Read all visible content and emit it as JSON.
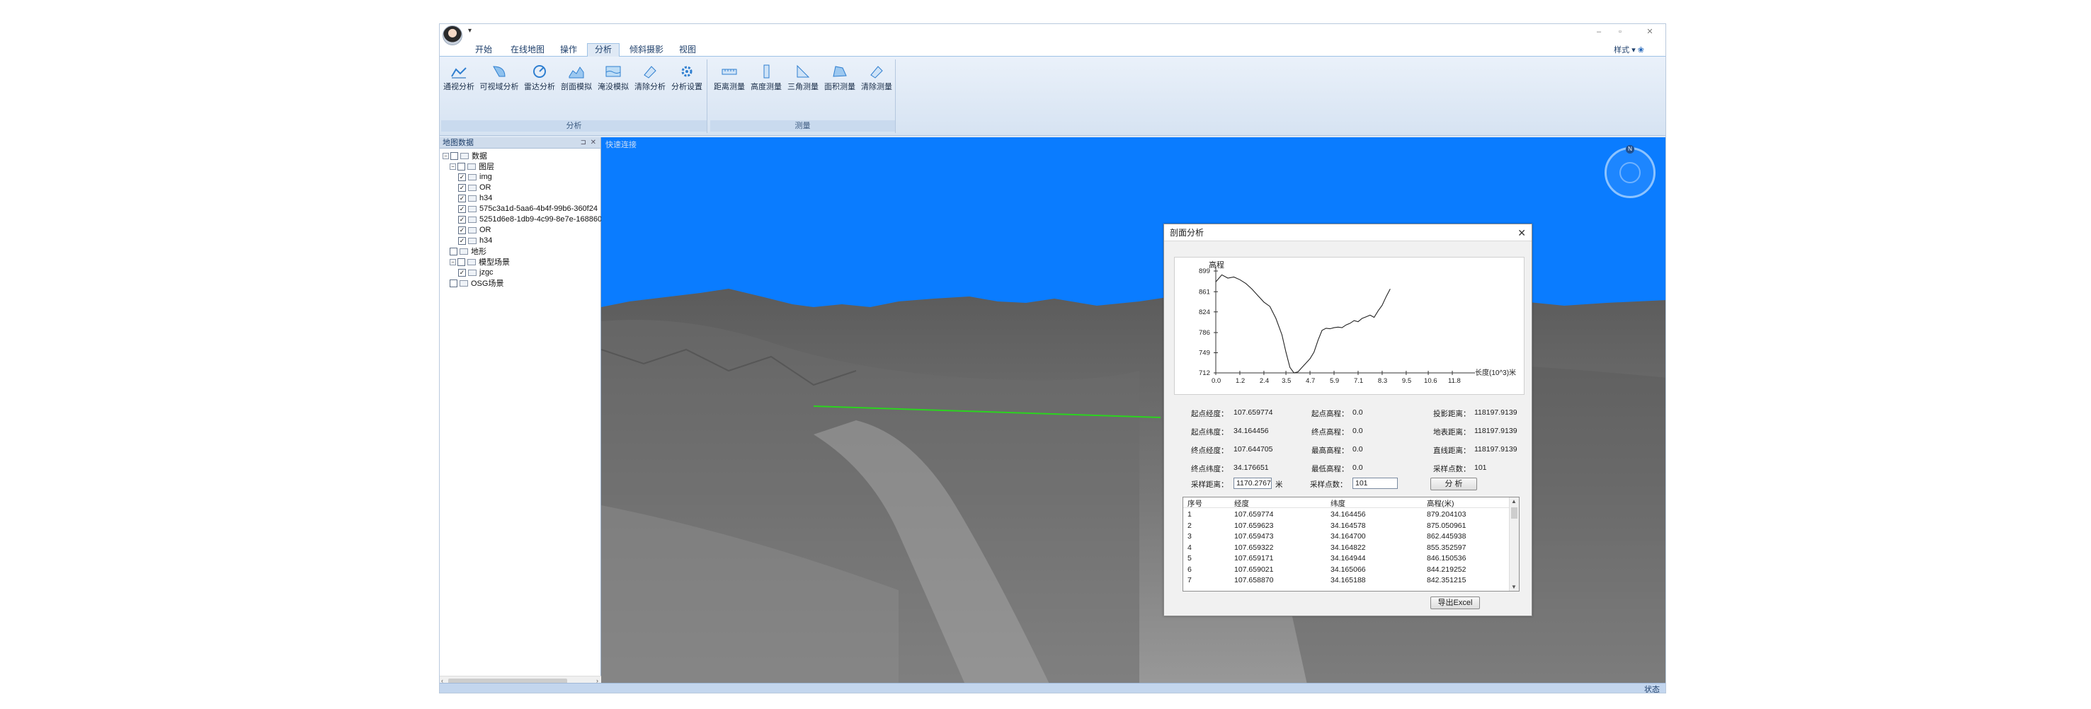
{
  "app": {
    "qat_label": "▾",
    "style_label": "样式",
    "window_controls": [
      "–",
      "▫",
      "✕"
    ]
  },
  "menus": [
    "开始",
    "在线地图",
    "操作",
    "分析",
    "倾斜摄影",
    "视图"
  ],
  "active_menu": "分析",
  "ribbon": {
    "groups": [
      {
        "caption": "分析",
        "buttons": [
          "通视分析",
          "可视域分析",
          "雷达分析",
          "剖面模拟",
          "淹没模拟",
          "清除分析",
          "分析设置"
        ]
      },
      {
        "caption": "测量",
        "buttons": [
          "距离测量",
          "高度测量",
          "三角测量",
          "面积测量",
          "清除测量"
        ]
      }
    ]
  },
  "left_panel": {
    "title": "地图数据",
    "pin": "⊐",
    "close": "✕",
    "tree": [
      {
        "label": "数据",
        "level": 0,
        "checked": false,
        "expander": "−"
      },
      {
        "label": "图层",
        "level": 1,
        "checked": false,
        "expander": "−"
      },
      {
        "label": "img",
        "level": 2,
        "checked": true
      },
      {
        "label": "OR",
        "level": 2,
        "checked": true
      },
      {
        "label": "h34",
        "level": 2,
        "checked": true
      },
      {
        "label": "575c3a1d-5aa6-4b4f-99b6-360f24",
        "level": 2,
        "checked": true
      },
      {
        "label": "5251d6e8-1db9-4c99-8e7e-168860",
        "level": 2,
        "checked": true
      },
      {
        "label": "OR",
        "level": 2,
        "checked": true
      },
      {
        "label": "h34",
        "level": 2,
        "checked": true
      },
      {
        "label": "地形",
        "level": 1,
        "checked": false
      },
      {
        "label": "模型场景",
        "level": 1,
        "checked": false,
        "expander": "−"
      },
      {
        "label": "jzgc",
        "level": 2,
        "checked": true
      },
      {
        "label": "OSG场景",
        "level": 1,
        "checked": false
      }
    ]
  },
  "viewport": {
    "caption": "快速连接",
    "compass_label": "N"
  },
  "statusbar": {
    "text": "状态"
  },
  "dialog": {
    "title": "剖面分析",
    "close": "✕",
    "info": [
      {
        "label": "起点经度：",
        "value": "107.659774"
      },
      {
        "label": "起点纬度：",
        "value": "34.164456"
      },
      {
        "label": "终点经度：",
        "value": "107.644705"
      },
      {
        "label": "终点纬度：",
        "value": "34.176651"
      },
      {
        "label": "起点高程：",
        "value": "0.0"
      },
      {
        "label": "终点高程：",
        "value": "0.0"
      },
      {
        "label": "最高高程：",
        "value": "0.0"
      },
      {
        "label": "最低高程：",
        "value": "0.0"
      },
      {
        "label": "投影距离：",
        "value": "118197.9139"
      },
      {
        "label": "地表距离：",
        "value": "118197.9139"
      },
      {
        "label": "直线距离：",
        "value": "118197.9139"
      },
      {
        "label": "采样点数：",
        "value": "101"
      }
    ],
    "sample_distance_label": "采样距离：",
    "sample_distance_value": "1170.2767",
    "sample_distance_unit": "米",
    "sample_count_label": "采样点数：",
    "sample_count_value": "101",
    "analyze_button": "分  析",
    "export_button": "导出Excel",
    "table": {
      "headers": [
        "序号",
        "经度",
        "纬度",
        "高程(米)"
      ],
      "rows": [
        [
          "1",
          "107.659774",
          "34.164456",
          "879.204103"
        ],
        [
          "2",
          "107.659623",
          "34.164578",
          "875.050961"
        ],
        [
          "3",
          "107.659473",
          "34.164700",
          "862.445938"
        ],
        [
          "4",
          "107.659322",
          "34.164822",
          "855.352597"
        ],
        [
          "5",
          "107.659171",
          "34.164944",
          "846.150536"
        ],
        [
          "6",
          "107.659021",
          "34.165066",
          "844.219252"
        ],
        [
          "7",
          "107.658870",
          "34.165188",
          "842.351215"
        ]
      ]
    }
  },
  "chart_data": {
    "type": "line",
    "title": "",
    "ylabel": "高程",
    "xlabel": "长度(10^3)米",
    "x_ticks": [
      "0.0",
      "1.2",
      "2.4",
      "3.5",
      "4.7",
      "5.9",
      "7.1",
      "8.3",
      "9.5",
      "10.6",
      "11.8"
    ],
    "y_ticks": [
      "712",
      "749",
      "786",
      "824",
      "861",
      "899"
    ],
    "xlim": [
      0,
      11.8
    ],
    "ylim": [
      712,
      899
    ],
    "grid": false,
    "series": [
      {
        "x": [
          0,
          0.3,
          0.6,
          0.9,
          1.2,
          1.5,
          1.8,
          2.1,
          2.4,
          2.7,
          3.0,
          3.3,
          3.5,
          3.7,
          3.9,
          4.1,
          4.3,
          4.5,
          4.7,
          4.9,
          5.1,
          5.3,
          5.5,
          5.7,
          5.9,
          6.1,
          6.3,
          6.5,
          6.7,
          6.9,
          7.1,
          7.3,
          7.5,
          7.7,
          7.9,
          8.1,
          8.3,
          8.5,
          8.7
        ],
        "y": [
          879,
          892,
          886,
          888,
          883,
          876,
          866,
          854,
          842,
          834,
          812,
          782,
          750,
          722,
          712,
          714,
          722,
          730,
          738,
          750,
          772,
          790,
          794,
          793,
          795,
          796,
          795,
          800,
          803,
          808,
          806,
          812,
          815,
          818,
          814,
          826,
          836,
          852,
          866
        ]
      }
    ]
  }
}
